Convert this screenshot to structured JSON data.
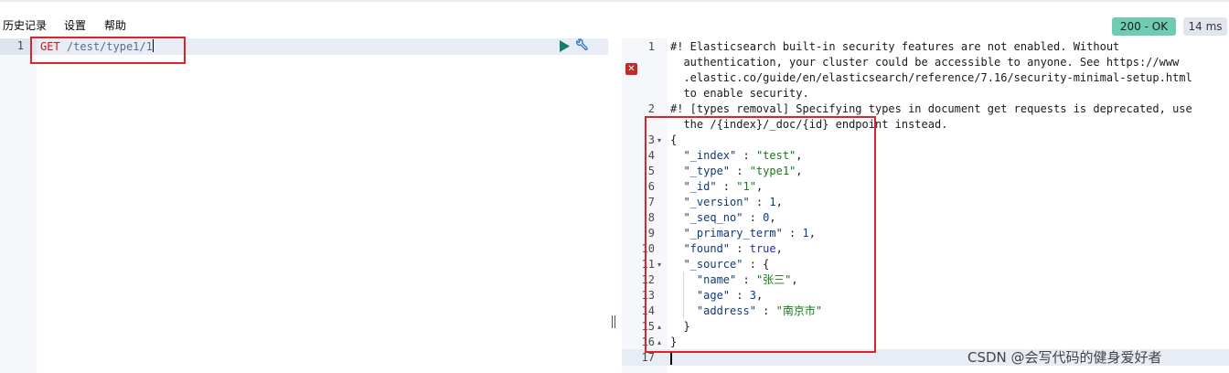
{
  "menu": {
    "history": "历史记录",
    "settings": "设置",
    "help": "帮助"
  },
  "status": {
    "code": "200 - OK",
    "code_color": "#6dccb1",
    "time": "14 ms"
  },
  "request": {
    "line_number": "1",
    "method": "GET",
    "url": "/test/type1/1",
    "icons": [
      "play-icon",
      "wrench-icon"
    ]
  },
  "response": {
    "line_numbers": [
      "1",
      "2",
      "3",
      "4",
      "5",
      "6",
      "7",
      "8",
      "9",
      "10",
      "11",
      "12",
      "13",
      "14",
      "15",
      "16",
      "17"
    ],
    "warning1": [
      "#! Elasticsearch built-in security features are not enabled. Without",
      "  authentication, your cluster could be accessible to anyone. See https://www",
      "  .elastic.co/guide/en/elasticsearch/reference/7.16/security-minimal-setup.html",
      "  to enable security."
    ],
    "warning2": [
      "#! [types removal] Specifying types in document get requests is deprecated, use",
      "  the /{index}/_doc/{id} endpoint instead."
    ],
    "json": {
      "open_brace": "{",
      "index_key": "\"_index\"",
      "index_val": "\"test\"",
      "type_key": "\"_type\"",
      "type_val": "\"type1\"",
      "id_key": "\"_id\"",
      "id_val": "\"1\"",
      "version_key": "\"_version\"",
      "version_val": "1",
      "seq_no_key": "\"_seq_no\"",
      "seq_no_val": "0",
      "primary_term_key": "\"_primary_term\"",
      "primary_term_val": "1",
      "found_key": "\"found\"",
      "found_val": "true",
      "source_key": "\"_source\"",
      "name_key": "\"name\"",
      "name_val": "\"张三\"",
      "age_key": "\"age\"",
      "age_val": "3",
      "address_key": "\"address\"",
      "address_val": "\"南京市\"",
      "close_inner": "}",
      "close_outer": "}"
    }
  },
  "watermark": "CSDN @会写代码的健身爱好者",
  "annotation_color": "#d9252b"
}
